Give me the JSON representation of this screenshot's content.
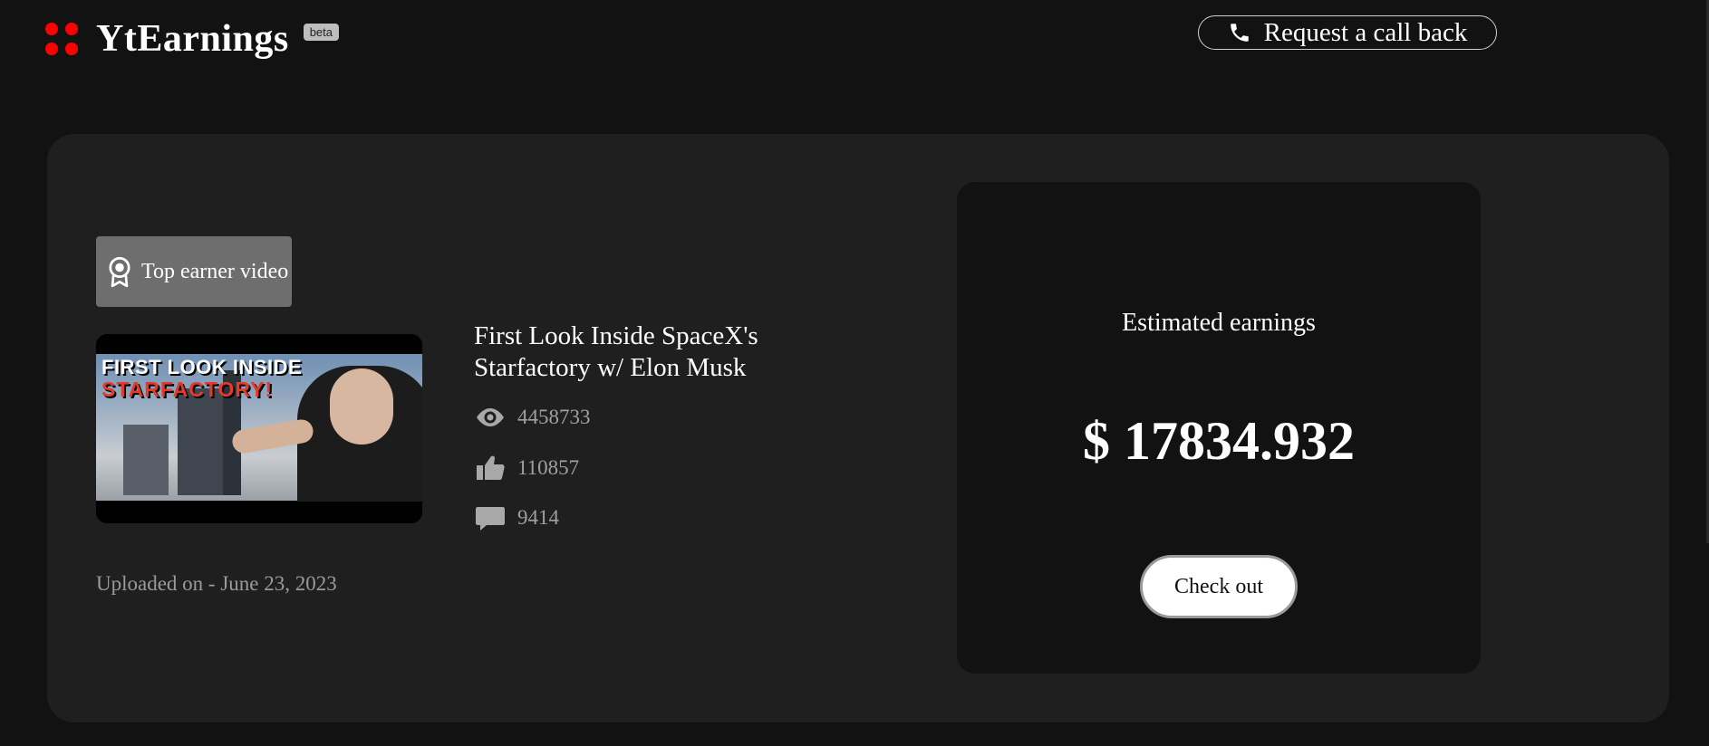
{
  "header": {
    "brand": "YtEarnings",
    "beta": "beta",
    "callback_label": "Request a call back"
  },
  "video": {
    "badge": "Top earner video",
    "thumbnail_line1": "FIRST LOOK INSIDE",
    "thumbnail_line2": "STARFACTORY!",
    "title": "First Look Inside SpaceX's Starfactory w/ Elon Musk",
    "views": "4458733",
    "likes": "110857",
    "comments": "9414",
    "uploaded": "Uploaded on - June 23, 2023"
  },
  "earnings": {
    "label": "Estimated earnings",
    "value": "$ 17834.932",
    "checkout_label": "Check out"
  },
  "colors": {
    "background": "#121212",
    "card": "#1f1f1f",
    "accent": "#ff0000",
    "badge": "#6e6e6e"
  },
  "icons": [
    "logo-dots-icon",
    "phone-icon",
    "award-icon",
    "eye-icon",
    "thumbs-up-icon",
    "comment-icon"
  ]
}
